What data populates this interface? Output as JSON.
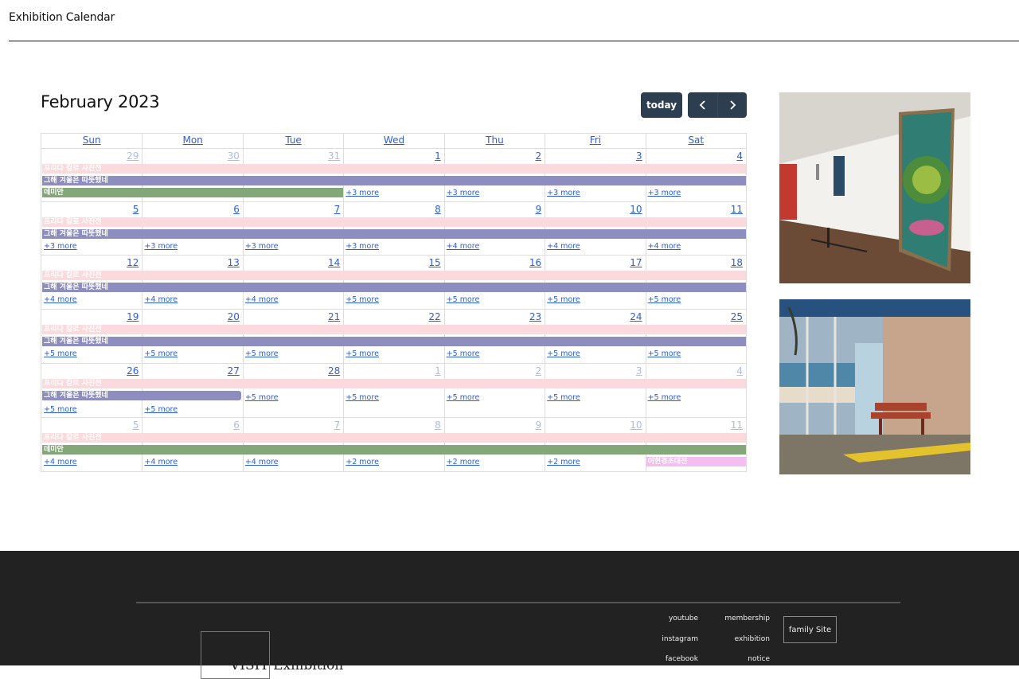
{
  "site": {
    "title": "Exhibition Calendar"
  },
  "calendar": {
    "title": "February 2023",
    "today_label": "today",
    "prev_icon": "‹",
    "next_icon": "›",
    "weekdays": [
      "Sun",
      "Mon",
      "Tue",
      "Wed",
      "Thu",
      "Fri",
      "Sat"
    ],
    "weeks": [
      {
        "days": [
          "29",
          "30",
          "31",
          "1",
          "2",
          "3",
          "4"
        ],
        "other": [
          true,
          true,
          true,
          false,
          false,
          false,
          false
        ],
        "events": [
          {
            "title": "프리다 칼로 사진전",
            "color": "pink",
            "start": 0,
            "span": 7,
            "row": 0
          },
          {
            "title": "그해 겨울은 따뜻했네",
            "color": "purple",
            "start": 0,
            "span": 7,
            "row": 1
          },
          {
            "title": "데미안",
            "color": "green",
            "start": 0,
            "span": 3,
            "row": 2
          }
        ],
        "more": [
          null,
          null,
          null,
          "+3 more",
          "+3 more",
          "+3 more",
          "+3 more"
        ],
        "more_row": 2
      },
      {
        "days": [
          "5",
          "6",
          "7",
          "8",
          "9",
          "10",
          "11"
        ],
        "other": [
          false,
          false,
          false,
          false,
          false,
          false,
          false
        ],
        "events": [
          {
            "title": "프리다 칼로 사진전",
            "color": "pink",
            "start": 0,
            "span": 7,
            "row": 0
          },
          {
            "title": "그해 겨울은 따뜻했네",
            "color": "purple",
            "start": 0,
            "span": 7,
            "row": 1
          }
        ],
        "more": [
          "+3 more",
          "+3 more",
          "+3 more",
          "+3 more",
          "+4 more",
          "+4 more",
          "+4 more"
        ],
        "more_row": 2
      },
      {
        "days": [
          "12",
          "13",
          "14",
          "15",
          "16",
          "17",
          "18"
        ],
        "other": [
          false,
          false,
          false,
          false,
          false,
          false,
          false
        ],
        "events": [
          {
            "title": "프리다 칼로 사진전",
            "color": "pink",
            "start": 0,
            "span": 7,
            "row": 0
          },
          {
            "title": "그해 겨울은 따뜻했네",
            "color": "purple",
            "start": 0,
            "span": 7,
            "row": 1
          }
        ],
        "more": [
          "+4 more",
          "+4 more",
          "+4 more",
          "+5 more",
          "+5 more",
          "+5 more",
          "+5 more"
        ],
        "more_row": 2
      },
      {
        "days": [
          "19",
          "20",
          "21",
          "22",
          "23",
          "24",
          "25"
        ],
        "other": [
          false,
          false,
          false,
          false,
          false,
          false,
          false
        ],
        "events": [
          {
            "title": "프리다 칼로 사진전",
            "color": "pink",
            "start": 0,
            "span": 7,
            "row": 0
          },
          {
            "title": "그해 겨울은 따뜻했네",
            "color": "purple",
            "start": 0,
            "span": 7,
            "row": 1
          }
        ],
        "more": [
          "+5 more",
          "+5 more",
          "+5 more",
          "+5 more",
          "+5 more",
          "+5 more",
          "+5 more"
        ],
        "more_row": 2
      },
      {
        "days": [
          "26",
          "27",
          "28",
          "1",
          "2",
          "3",
          "4"
        ],
        "other": [
          false,
          false,
          false,
          true,
          true,
          true,
          true
        ],
        "events": [
          {
            "title": "프리다 칼로 사진전",
            "color": "pink",
            "start": 0,
            "span": 7,
            "row": 0
          },
          {
            "title": "그해 겨울은 따뜻했네",
            "color": "purple",
            "start": 0,
            "span": 2,
            "row": 1,
            "ends": true
          }
        ],
        "more": [
          "+5 more",
          "+5 more",
          "+5 more",
          "+5 more",
          "+5 more",
          "+5 more",
          "+5 more"
        ],
        "more_rows": [
          2,
          2,
          1,
          1,
          1,
          1,
          1
        ]
      },
      {
        "days": [
          "5",
          "6",
          "7",
          "8",
          "9",
          "10",
          "11"
        ],
        "other": [
          true,
          true,
          true,
          true,
          true,
          true,
          true
        ],
        "events": [
          {
            "title": "프리다 칼로 사진전",
            "color": "pink",
            "start": 0,
            "span": 7,
            "row": 0
          },
          {
            "title": "데미안",
            "color": "green",
            "start": 0,
            "span": 7,
            "row": 1
          },
          {
            "title": "이현경초대전",
            "color": "magenta",
            "start": 6,
            "span": 1,
            "row": 2
          }
        ],
        "more": [
          "+4 more",
          "+4 more",
          "+4 more",
          "+2 more",
          "+2 more",
          "+2 more",
          null
        ],
        "more_row": 2
      }
    ]
  },
  "side_images": [
    {
      "name": "gallery-wall-painting-image",
      "colors": [
        "#e9e7e3",
        "#2a7a6e"
      ]
    },
    {
      "name": "beach-bench-photo-image",
      "colors": [
        "#2f5e95",
        "#a9472f"
      ]
    }
  ],
  "footer": {
    "links": [
      "youtube",
      "membership",
      "instagram",
      "exhibition",
      "facebook",
      "notice"
    ],
    "family_site": "family Site",
    "logo_text": "VISIT Exhibition"
  }
}
